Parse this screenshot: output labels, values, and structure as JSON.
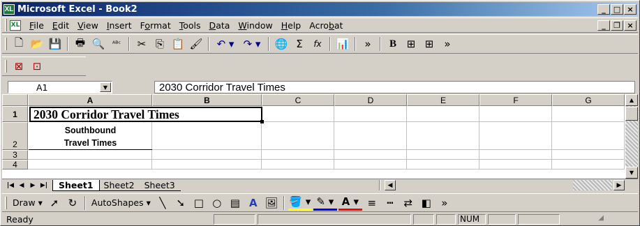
{
  "window": {
    "title": "Microsoft Excel - Book2",
    "app_icon": "excel-icon",
    "doc_icon_label": "XL"
  },
  "caption_buttons": {
    "minimize": "_",
    "maximize": "□",
    "close": "×"
  },
  "doc_buttons": {
    "minimize": "_",
    "restore": "❐",
    "close": "×"
  },
  "menu": {
    "items": [
      {
        "pre": "",
        "u": "F",
        "post": "ile"
      },
      {
        "pre": "",
        "u": "E",
        "post": "dit"
      },
      {
        "pre": "",
        "u": "V",
        "post": "iew"
      },
      {
        "pre": "",
        "u": "I",
        "post": "nsert"
      },
      {
        "pre": "F",
        "u": "o",
        "post": "rmat"
      },
      {
        "pre": "",
        "u": "T",
        "post": "ools"
      },
      {
        "pre": "",
        "u": "D",
        "post": "ata"
      },
      {
        "pre": "",
        "u": "W",
        "post": "indow"
      },
      {
        "pre": "",
        "u": "H",
        "post": "elp"
      },
      {
        "pre": "Acro",
        "u": "b",
        "post": "at"
      }
    ]
  },
  "standard_toolbar": {
    "groups": [
      [
        {
          "icon": "new-icon",
          "glyph": "🗋"
        },
        {
          "icon": "open-icon",
          "glyph": "📂"
        },
        {
          "icon": "save-icon",
          "glyph": "💾"
        }
      ],
      [
        {
          "icon": "print-icon",
          "glyph": "🖶"
        },
        {
          "icon": "print-preview-icon",
          "glyph": "🔍"
        },
        {
          "icon": "spelling-icon",
          "glyph": "ᴬᴮᶜ"
        }
      ],
      [
        {
          "icon": "cut-icon",
          "glyph": "✂"
        },
        {
          "icon": "copy-icon",
          "glyph": "⎘"
        },
        {
          "icon": "paste-icon",
          "glyph": "📋"
        },
        {
          "icon": "format-painter-icon",
          "glyph": "🖌"
        }
      ],
      [
        {
          "icon": "undo-icon",
          "glyph": "↶ ▾"
        },
        {
          "icon": "redo-icon",
          "glyph": "↷ ▾"
        }
      ],
      [
        {
          "icon": "hyperlink-icon",
          "glyph": "🌐"
        },
        {
          "icon": "autosum-icon",
          "glyph": "Σ"
        },
        {
          "icon": "function-icon",
          "glyph": "fx"
        }
      ],
      [
        {
          "icon": "chart-wizard-icon",
          "glyph": "📊"
        }
      ],
      [
        {
          "icon": "more-buttons-icon",
          "glyph": "»"
        }
      ],
      [
        {
          "icon": "bold-icon",
          "glyph": "B"
        },
        {
          "icon": "merge-center-icon",
          "glyph": "⊞"
        },
        {
          "icon": "merge-center-2-icon",
          "glyph": "⊞"
        },
        {
          "icon": "overflow-icon",
          "glyph": "»"
        }
      ]
    ]
  },
  "acrobat_toolbar": [
    {
      "icon": "convert-to-pdf-icon",
      "glyph": "⊠"
    },
    {
      "icon": "convert-and-email-icon",
      "glyph": "⊡"
    }
  ],
  "formula_bar": {
    "name_box": "A1",
    "equals": "=",
    "content": "2030 Corridor Travel Times"
  },
  "sheet": {
    "columns": [
      "A",
      "B",
      "C",
      "D",
      "E",
      "F",
      "G"
    ],
    "rows": [
      "1",
      "2",
      "3",
      "4"
    ],
    "cells": {
      "A1": "2030 Corridor Travel Times",
      "A2_line1": "Southbound",
      "A2_line2": "Travel Times"
    }
  },
  "tabs": [
    "Sheet1",
    "Sheet2",
    "Sheet3"
  ],
  "tab_nav": [
    "|◀",
    "◀",
    "▶",
    "▶|"
  ],
  "drawing_toolbar": {
    "draw_label": "Draw",
    "autoshapes_label": "AutoShapes",
    "tools": [
      {
        "icon": "line-icon",
        "glyph": "╲"
      },
      {
        "icon": "arrow-icon",
        "glyph": "➘"
      },
      {
        "icon": "rectangle-icon",
        "glyph": "□"
      },
      {
        "icon": "oval-icon",
        "glyph": "○"
      },
      {
        "icon": "textbox-icon",
        "glyph": "▤"
      },
      {
        "icon": "wordart-icon",
        "glyph": "A"
      },
      {
        "icon": "clipart-icon",
        "glyph": "🖼"
      }
    ],
    "format_tools": [
      {
        "icon": "fill-color-icon",
        "glyph": "🪣 ▾"
      },
      {
        "icon": "line-color-icon",
        "glyph": "✎ ▾"
      },
      {
        "icon": "font-color-icon",
        "glyph": "A ▾"
      },
      {
        "icon": "line-style-icon",
        "glyph": "≡"
      },
      {
        "icon": "dash-style-icon",
        "glyph": "┅"
      },
      {
        "icon": "arrow-style-icon",
        "glyph": "⇄"
      },
      {
        "icon": "3d-icon",
        "glyph": "◧"
      },
      {
        "icon": "more-buttons-icon",
        "glyph": "»"
      }
    ]
  },
  "status": {
    "text": "Ready",
    "num": "NUM"
  },
  "colors": {
    "titlebar_start": "#0a246a",
    "titlebar_end": "#a6caf0",
    "chrome": "#d4d0c8",
    "fill_color": "#ffff00",
    "line_color": "#0000ff",
    "font_color": "#ff0000"
  }
}
